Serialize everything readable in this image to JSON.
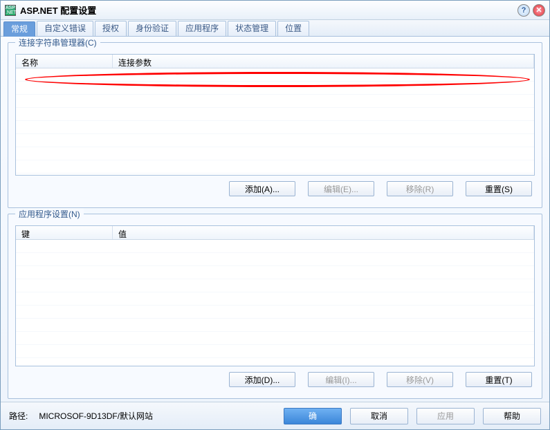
{
  "title": "ASP.NET 配置设置",
  "tabs": [
    "常规",
    "自定义错误",
    "授权",
    "身份验证",
    "应用程序",
    "状态管理",
    "位置"
  ],
  "activeTab": 0,
  "group1": {
    "legend": "连接字符串管理器(C)",
    "cols": {
      "name": "名称",
      "param": "连接参数"
    },
    "buttons": {
      "add": "添加(A)...",
      "edit": "编辑(E)...",
      "remove": "移除(R)",
      "reset": "重置(S)"
    }
  },
  "group2": {
    "legend": "应用程序设置(N)",
    "cols": {
      "key": "键",
      "val": "值"
    },
    "buttons": {
      "add": "添加(D)...",
      "edit": "编辑(I)...",
      "remove": "移除(V)",
      "reset": "重置(T)"
    }
  },
  "footer": {
    "pathLabel": "路径:",
    "pathValue": "MICROSOF-9D13DF/默认网站",
    "ok": "确",
    "cancel": "取消",
    "apply": "应用",
    "help": "帮助"
  }
}
